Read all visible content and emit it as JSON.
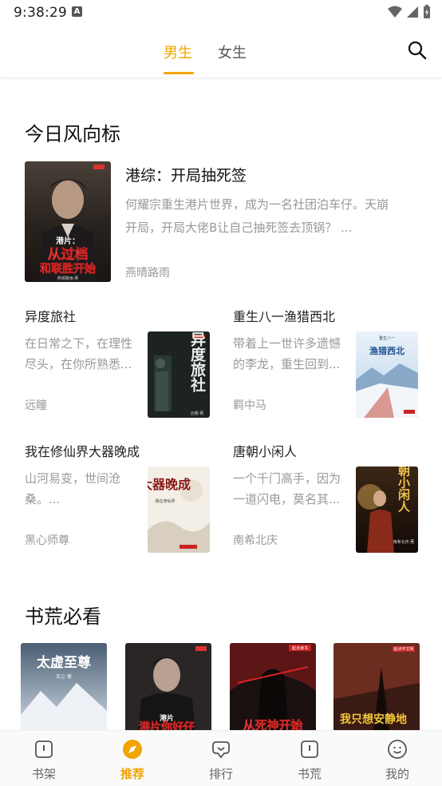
{
  "status_bar": {
    "time": "9:38:29",
    "badge": "A"
  },
  "header": {
    "tabs": [
      {
        "label": "男生",
        "active": true
      },
      {
        "label": "女生",
        "active": false
      }
    ],
    "accent_color": "#f0a500"
  },
  "sections": {
    "today_title": "今日风向标",
    "must_read_title": "书荒必看"
  },
  "featured": {
    "title": "港综：开局抽死签",
    "desc": "何耀宗重生港片世界，成为一名社团泊车仔。天崩开局，开局大佬B让自己抽死签去顶锅？ ...",
    "author": "燕晴路雨",
    "cover_text": [
      "港片：",
      "从过档",
      "和联胜开始"
    ],
    "cover_small": "燕晴路雨·著"
  },
  "books": [
    {
      "title": "异度旅社",
      "desc": "在日常之下，在理性尽头，在你所熟悉...",
      "author": "远瞳",
      "cover_text": "异度旅社",
      "cover_small": "远瞳·著"
    },
    {
      "title": "重生八一渔猎西北",
      "desc": "带着上一世许多遗憾的李龙，重生回到...",
      "author": "羁中马",
      "cover_text": "渔猎西北",
      "cover_small": "重生八一"
    },
    {
      "title": "我在修仙界大器晚成",
      "desc": "山河易变，世间沧桑。...",
      "author": "黑心师尊",
      "cover_text": "大器晚成",
      "cover_small": "我在修仙界"
    },
    {
      "title": "唐朝小闲人",
      "desc": "一个千门高手，因为一道闪电，莫名其...",
      "author": "南希北庆",
      "cover_text": "唐朝小闲人",
      "cover_small": "南希北庆·著"
    }
  ],
  "must_read": [
    {
      "cover_text": "太虚至尊",
      "cover_small": "玄尘·著"
    },
    {
      "cover_text": "港片你好仔",
      "cover_small": "港片"
    },
    {
      "cover_text": "从死神开始",
      "cover_small": "起点读书"
    },
    {
      "cover_text": "我只想安静地",
      "cover_small": "起点中文网"
    }
  ],
  "bottom_nav": [
    {
      "label": "书架",
      "icon": "bookshelf-icon",
      "active": false
    },
    {
      "label": "推荐",
      "icon": "compass-icon",
      "active": true
    },
    {
      "label": "排行",
      "icon": "ranking-icon",
      "active": false
    },
    {
      "label": "书荒",
      "icon": "book-famine-icon",
      "active": false
    },
    {
      "label": "我的",
      "icon": "profile-icon",
      "active": false
    }
  ]
}
